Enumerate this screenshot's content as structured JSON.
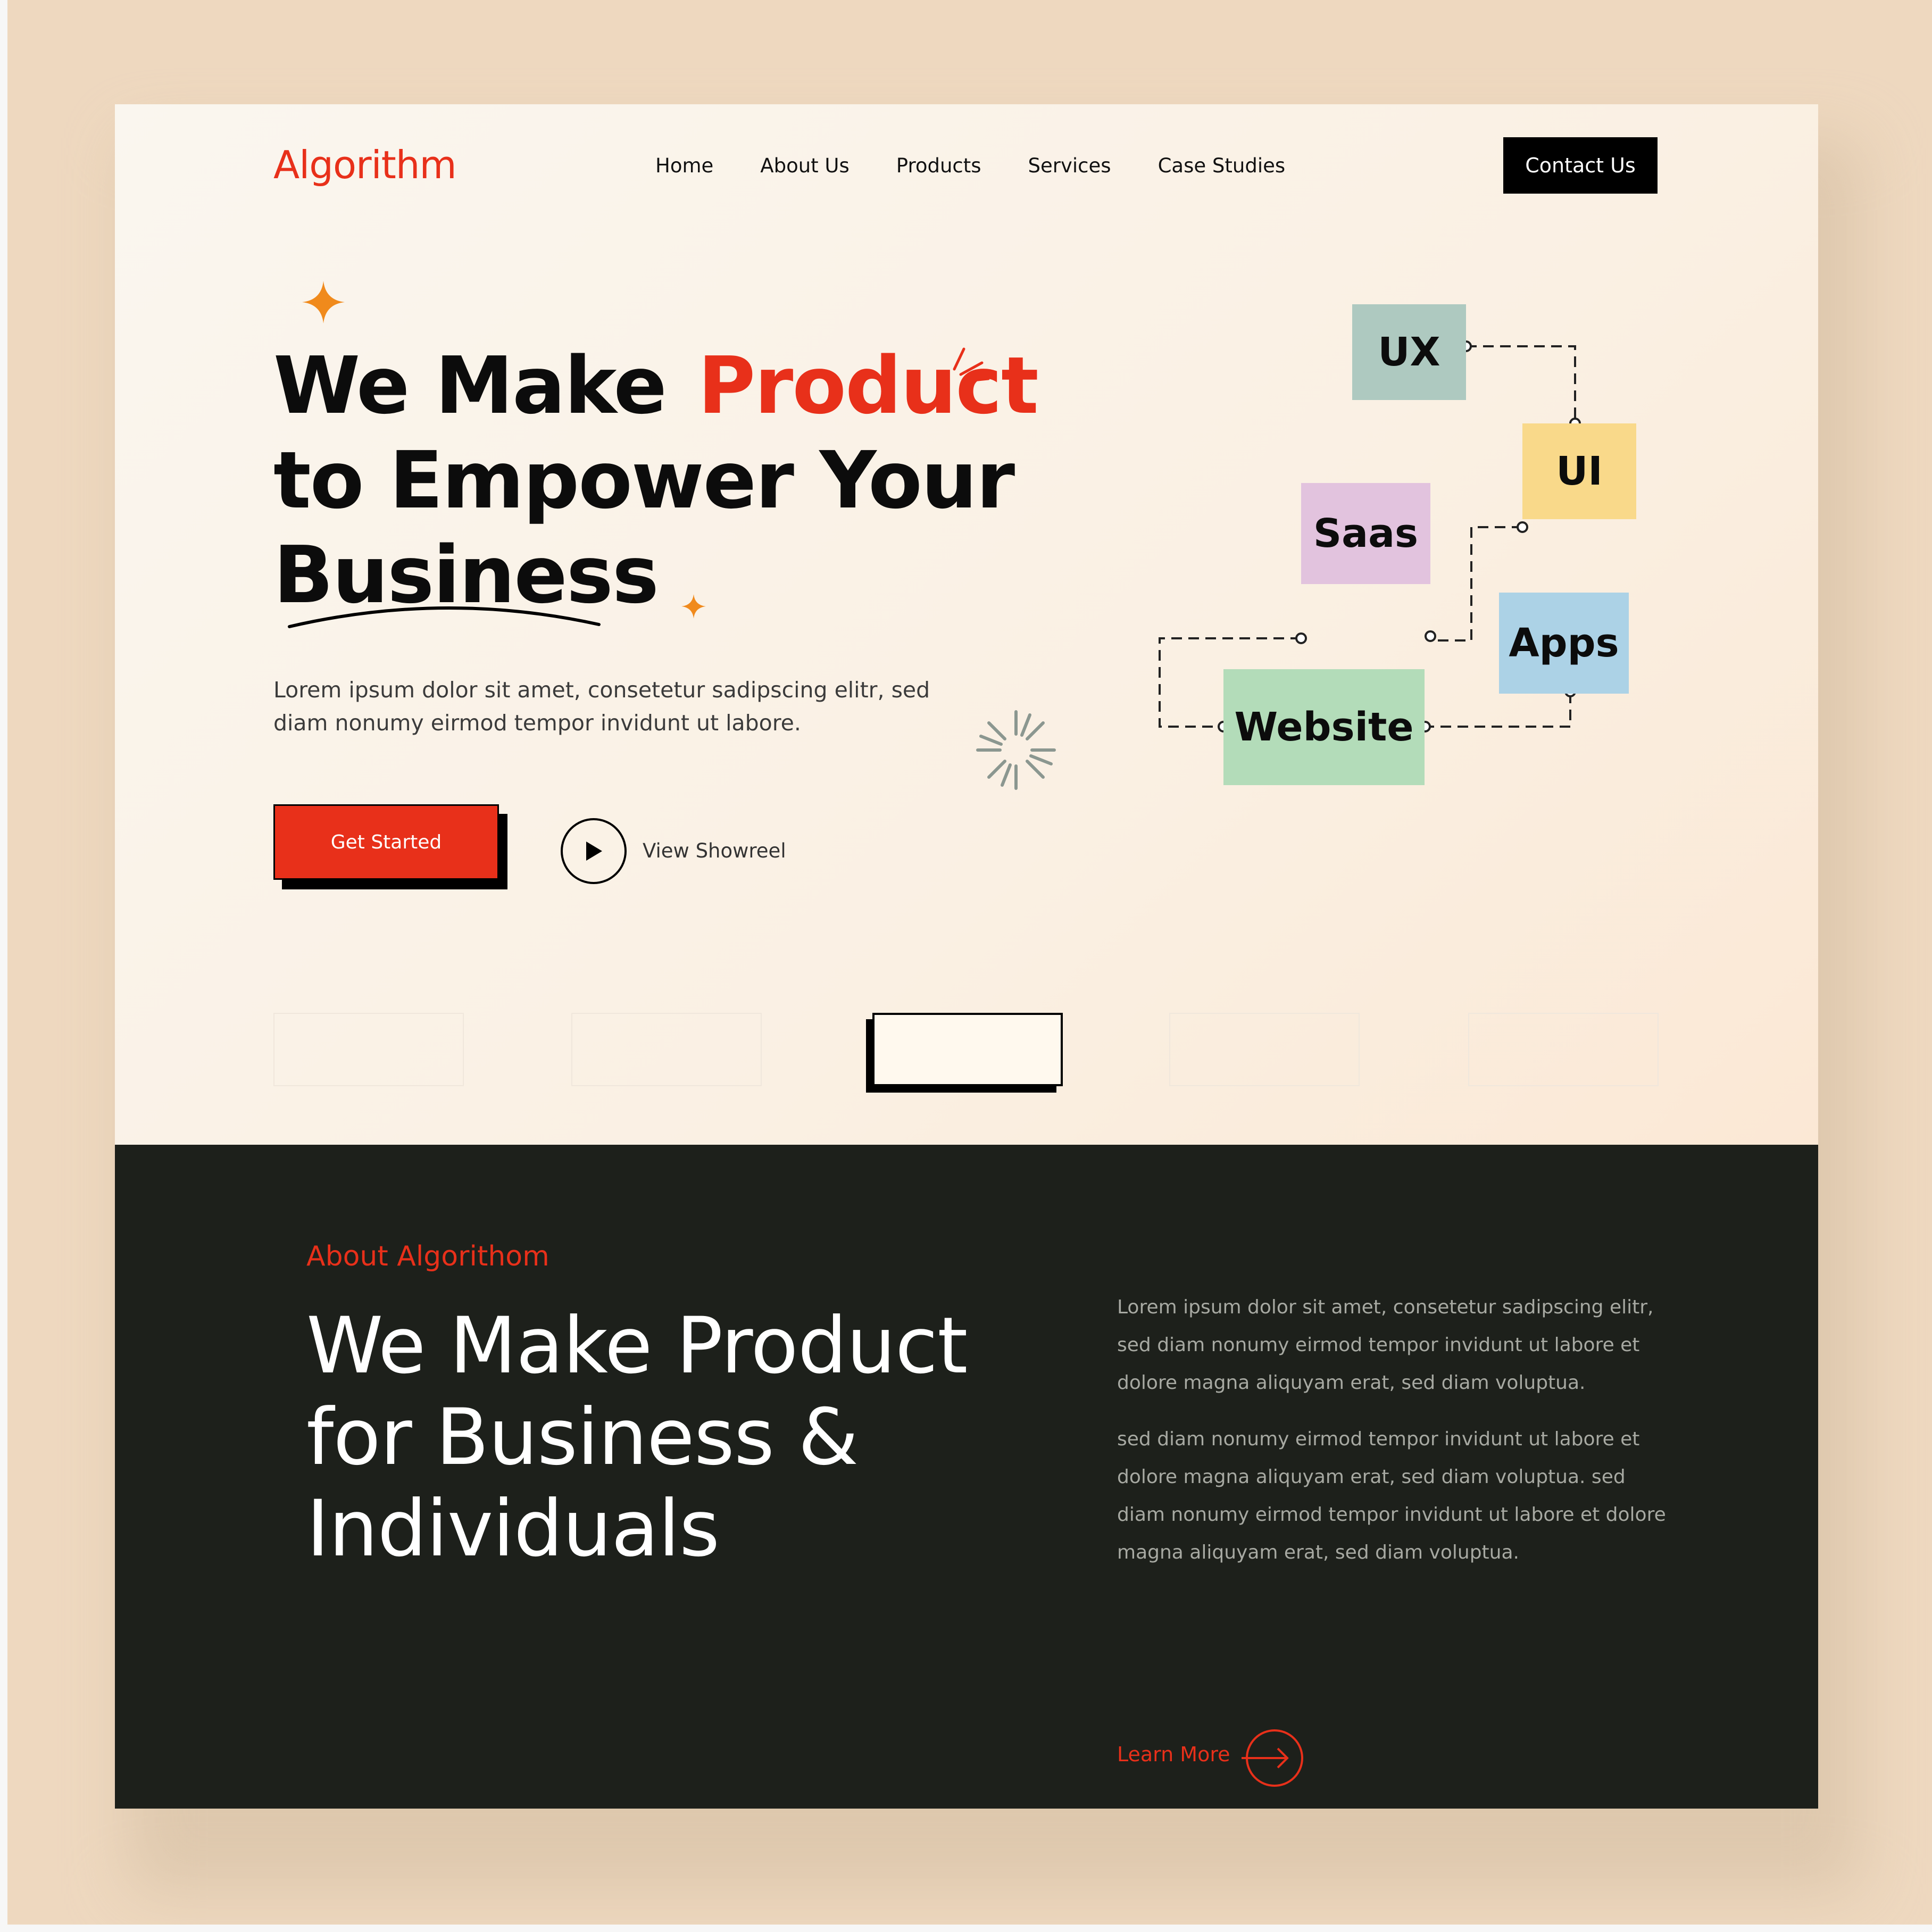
{
  "brand": {
    "logo": "Algorithm",
    "accent_color": "#e8301a",
    "dark_color": "#1d201b"
  },
  "nav": {
    "items": [
      "Home",
      "About Us",
      "Products",
      "Services",
      "Case Studies"
    ],
    "contact_label": "Contact Us"
  },
  "hero": {
    "title_line1": "We Make",
    "title_accent": "Product",
    "title_line2": "to Empower Your",
    "title_line3": "Business",
    "description": "Lorem ipsum dolor sit amet, consetetur sadipscing elitr, sed diam nonumy eirmod tempor invidunt ut labore.",
    "cta_label": "Get Started",
    "showreel_label": "View Showreel"
  },
  "diagram": {
    "nodes": [
      {
        "label": "UX",
        "color": "#aec9c0"
      },
      {
        "label": "UI",
        "color": "#f9d98a"
      },
      {
        "label": "Saas",
        "color": "#e2c3de"
      },
      {
        "label": "Apps",
        "color": "#acd2e6"
      },
      {
        "label": "Website",
        "color": "#b3dcb9"
      }
    ]
  },
  "about": {
    "kicker": "About Algorithom",
    "title": "We Make Product for Business & Individuals",
    "paragraph1": "Lorem ipsum dolor sit amet, consetetur sadipscing elitr, sed diam nonumy eirmod tempor invidunt ut labore et dolore magna aliquyam erat, sed diam voluptua.",
    "paragraph2": "sed diam nonumy eirmod tempor invidunt ut labore et dolore magna aliquyam erat, sed diam voluptua. sed diam nonumy eirmod tempor invidunt ut labore et dolore magna aliquyam erat, sed diam voluptua.",
    "learn_more_label": "Learn More"
  },
  "icons": {
    "play": "play-icon",
    "arrow": "arrow-right-circle-icon",
    "sparkle": "sparkle-star-icon",
    "burst": "burst-icon"
  }
}
